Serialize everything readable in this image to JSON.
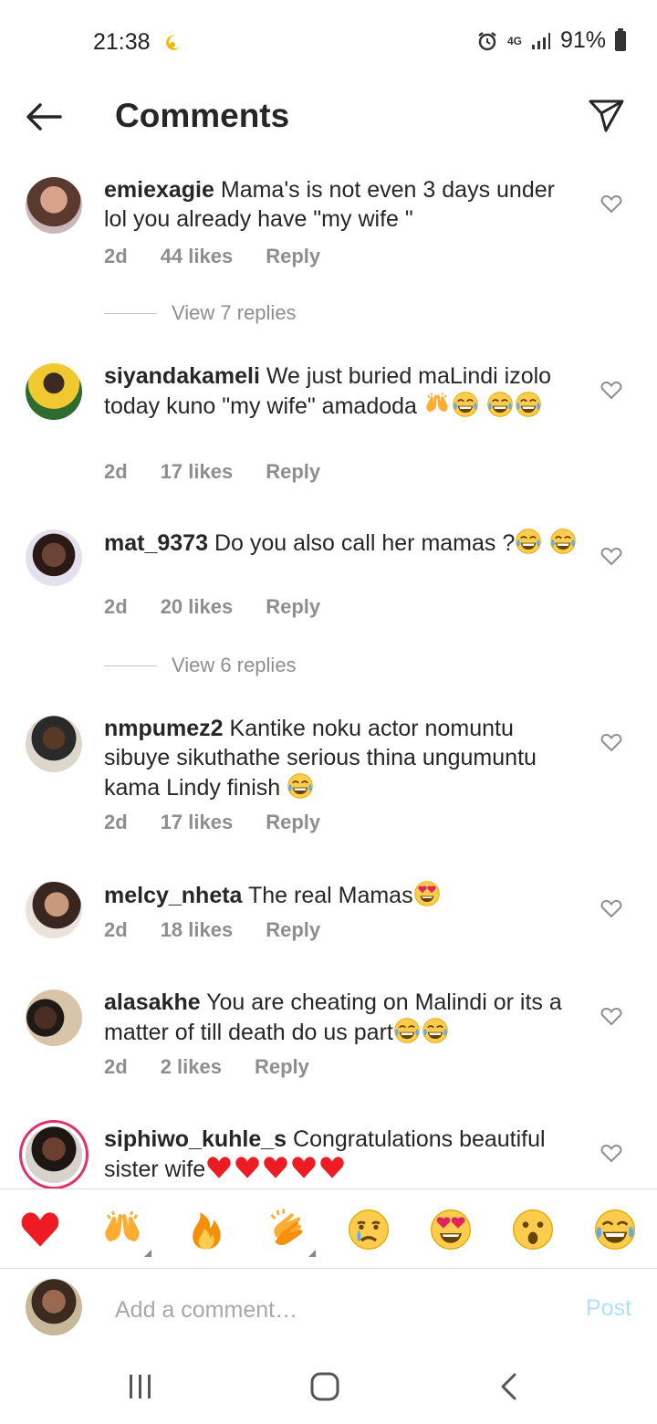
{
  "status_bar": {
    "time": "21:38",
    "network": "4G",
    "battery": "91%"
  },
  "header": {
    "title": "Comments"
  },
  "comments": [
    {
      "username": "emiexagie",
      "text": "Mama's is not even 3 days under lol you already have \"my wife \"",
      "time": "2d",
      "likes": "44 likes",
      "reply": "Reply"
    },
    {
      "username": "siyandakameli",
      "text": "We just buried maLindi izolo today kuno \"my wife\" amadoda ",
      "time": "2d",
      "likes": "17 likes",
      "reply": "Reply"
    },
    {
      "username": "mat_9373",
      "text": "Do you also call her mamas ?",
      "time": "2d",
      "likes": "20 likes",
      "reply": "Reply"
    },
    {
      "username": "nmpumez2",
      "text": "Kantike noku actor nomuntu sibuye sikuthathe serious thina ungumuntu kama Lindy finish ",
      "time": "2d",
      "likes": "17 likes",
      "reply": "Reply"
    },
    {
      "username": "melcy_nheta",
      "text": "The real Mamas",
      "time": "2d",
      "likes": "18 likes",
      "reply": "Reply"
    },
    {
      "username": "alasakhe",
      "text": "You are cheating on Malindi or its a matter of till death do us part",
      "time": "2d",
      "likes": "2 likes",
      "reply": "Reply"
    },
    {
      "username": "siphiwo_kuhle_s",
      "text": "Congratulations beautiful sister wife"
    }
  ],
  "view_replies": [
    "View 7 replies",
    "View 6 replies"
  ],
  "reactions": [
    "heart",
    "raising-hands",
    "fire",
    "clapping-hands",
    "crying-face",
    "heart-eyes",
    "surprised-face",
    "tears-of-joy"
  ],
  "composer": {
    "placeholder": "Add a comment…",
    "post_label": "Post"
  },
  "colors": {
    "text": "#262626",
    "secondary": "#8e8e8e",
    "post_disabled": "#b2dffc",
    "heart_red": "#ed1c24"
  }
}
